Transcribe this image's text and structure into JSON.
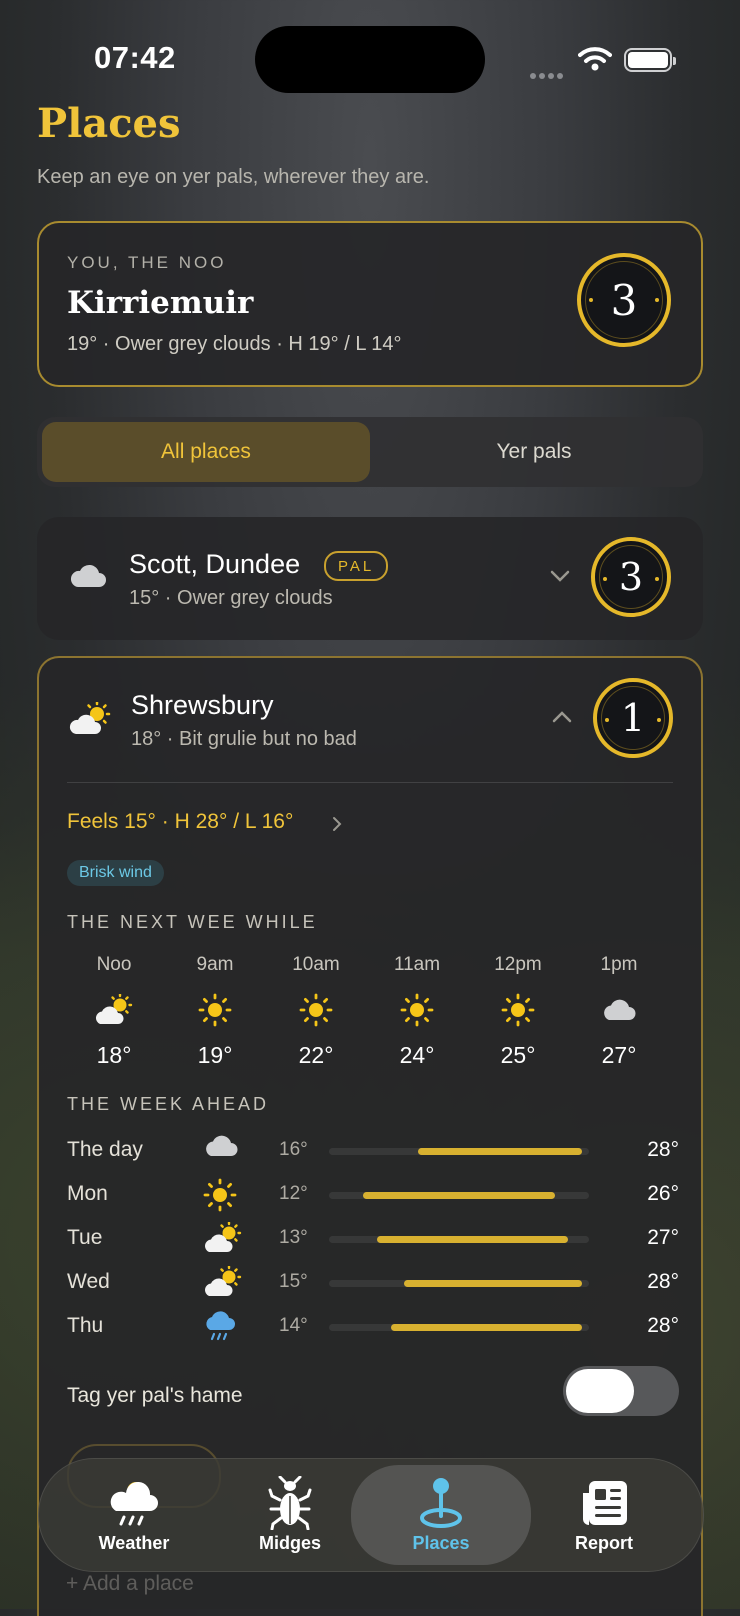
{
  "status": {
    "time": "07:42"
  },
  "header": {
    "title": "Places",
    "subtitle": "Keep an eye on yer pals, wherever they are."
  },
  "you_card": {
    "label": "YOU, THE NOO",
    "place": "Kirriemuir",
    "detail": "19° · Ower grey clouds · H 19° / L 14°",
    "badge": "3"
  },
  "segments": {
    "all": "All places",
    "pals": "Yer pals",
    "selected": "All places"
  },
  "places": [
    {
      "name": "Scott, Dundee",
      "tag": "PAL",
      "detail": "15° · Ower grey clouds",
      "badge": "3",
      "icon": "cloud-icon",
      "expanded": false
    },
    {
      "name": "Shrewsbury",
      "detail": "18° · Bit grulie but no bad",
      "badge": "1",
      "icon": "partly-sunny-icon",
      "expanded": true,
      "feels": "Feels 15° · H 28° / L 16°",
      "wind_tag": "Brisk wind",
      "hourly_label": "THE NEXT WEE WHILE",
      "hourly": [
        {
          "time": "Noo",
          "icon": "partly-sunny-icon",
          "temp": "18°"
        },
        {
          "time": "9am",
          "icon": "sun-icon",
          "temp": "19°"
        },
        {
          "time": "10am",
          "icon": "sun-icon",
          "temp": "22°"
        },
        {
          "time": "11am",
          "icon": "sun-icon",
          "temp": "24°"
        },
        {
          "time": "12pm",
          "icon": "sun-icon",
          "temp": "25°"
        },
        {
          "time": "1pm",
          "icon": "cloud-icon",
          "temp": "27°"
        }
      ],
      "week_label": "THE WEEK AHEAD",
      "week": [
        {
          "day": "The day",
          "icon": "cloud-icon",
          "low": "16°",
          "high": "28°"
        },
        {
          "day": "Mon",
          "icon": "sun-icon",
          "low": "12°",
          "high": "26°"
        },
        {
          "day": "Tue",
          "icon": "partly-sunny-icon",
          "low": "13°",
          "high": "27°"
        },
        {
          "day": "Wed",
          "icon": "partly-sunny-icon",
          "low": "15°",
          "high": "28°"
        },
        {
          "day": "Thu",
          "icon": "rain-icon",
          "low": "14°",
          "high": "28°"
        }
      ],
      "tag_home_label": "Tag yer pal's hame",
      "tag_home_on": false
    }
  ],
  "add_place": "+ Add a place",
  "tabbar": [
    {
      "label": "Weather",
      "icon": "weather-icon",
      "active": false
    },
    {
      "label": "Midges",
      "icon": "midge-icon",
      "active": false
    },
    {
      "label": "Places",
      "icon": "map-pin-icon",
      "active": true
    },
    {
      "label": "Report",
      "icon": "newspaper-icon",
      "active": false
    }
  ],
  "colors": {
    "accent": "#f0c43a",
    "active_tab": "#5fc3ea",
    "wind_tag": "#6cc9e6"
  }
}
